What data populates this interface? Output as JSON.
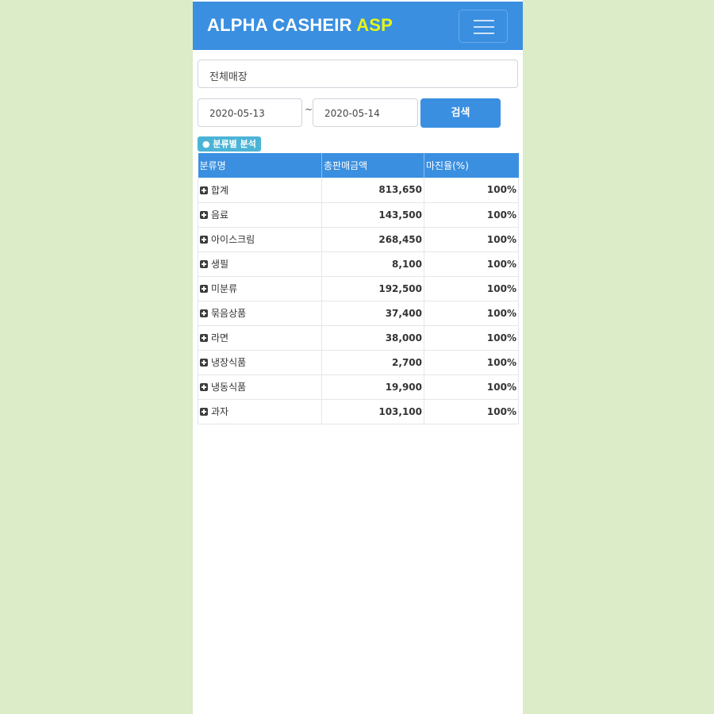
{
  "header": {
    "brand_main": "ALPHA CASHEIR ",
    "brand_accent": "ASP",
    "menu_icon": "hamburger-menu-icon"
  },
  "filters": {
    "store_value": "전체매장",
    "date_start": "2020-05-13",
    "date_separator": "~",
    "date_end": "2020-05-14",
    "search_label": "검색"
  },
  "section": {
    "badge_label": "● 분류별 분석"
  },
  "table": {
    "headers": [
      "분류명",
      "총판매금액",
      "마진율(%)"
    ],
    "rows": [
      {
        "name": "합계",
        "amount": "813,650",
        "margin": "100%"
      },
      {
        "name": "음료",
        "amount": "143,500",
        "margin": "100%"
      },
      {
        "name": "아이스크림",
        "amount": "268,450",
        "margin": "100%"
      },
      {
        "name": "생필",
        "amount": "8,100",
        "margin": "100%"
      },
      {
        "name": "미분류",
        "amount": "192,500",
        "margin": "100%"
      },
      {
        "name": "묶음상품",
        "amount": "37,400",
        "margin": "100%"
      },
      {
        "name": "라면",
        "amount": "38,000",
        "margin": "100%"
      },
      {
        "name": "냉장식품",
        "amount": "2,700",
        "margin": "100%"
      },
      {
        "name": "냉동식품",
        "amount": "19,900",
        "margin": "100%"
      },
      {
        "name": "과자",
        "amount": "103,100",
        "margin": "100%"
      }
    ]
  },
  "colors": {
    "primary": "#3a8fe0",
    "brand_accent": "#e8f516",
    "badge": "#4bb4d6",
    "page_background": "#dcebc8"
  }
}
